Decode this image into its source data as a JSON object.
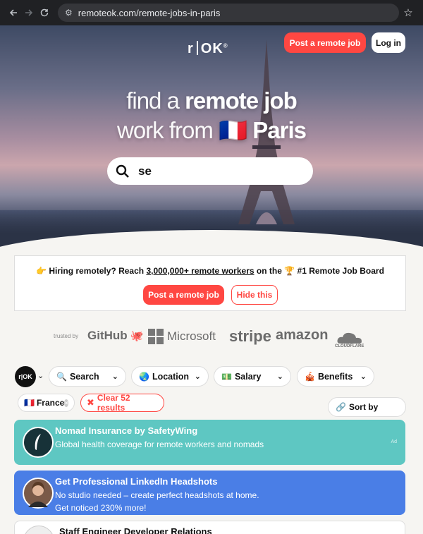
{
  "browser": {
    "url": "remoteok.com/remote-jobs-in-paris",
    "back_icon": "arrow-left-icon",
    "forward_icon": "arrow-right-icon",
    "reload_icon": "reload-icon",
    "bookmark_icon": "star-icon"
  },
  "header": {
    "logo_left": "r",
    "logo_right": "OK",
    "logo_mark": "®",
    "post_job_label": "Post a remote job",
    "login_label": "Log in"
  },
  "hero": {
    "line1_light": "find a",
    "line1_bold": "remote job",
    "line2_light": "work from",
    "flag": "🇫🇷",
    "line2_bold": "Paris"
  },
  "search": {
    "value": "se"
  },
  "hiring_banner": {
    "emoji": "👉",
    "text_before": "Hiring remotely? Reach",
    "link_text": "3,000,000+ remote workers",
    "text_middle": "on the",
    "trophy": "🏆",
    "text_after": "#1 Remote Job Board",
    "post_label": "Post a remote job",
    "hide_label": "Hide this"
  },
  "trusted": {
    "label": "trusted by",
    "brands": [
      "GitHub",
      "Microsoft",
      "stripe",
      "amazon",
      "CLOUDFLARE"
    ]
  },
  "filters": {
    "logo_left": "r",
    "logo_right": "OK",
    "search_label": "Search",
    "search_icon": "🔍",
    "location_label": "Location",
    "location_icon": "🌏",
    "salary_label": "Salary",
    "salary_icon": "💵",
    "benefits_label": "Benefits",
    "benefits_icon": "🎪"
  },
  "active_tags": {
    "france_flag": "🇫🇷",
    "france_label": "France",
    "clear_label": "Clear 52 results",
    "sort_label": "Sort by",
    "sort_icon": "🔗"
  },
  "cards": [
    {
      "title": "Nomad Insurance by SafetyWing",
      "desc": "Global health coverage for remote workers and nomads",
      "ad": "Ad",
      "color": "#5ec7c2"
    },
    {
      "title": "Get Professional LinkedIn Headshots",
      "desc": "No studio needed – create perfect headshots at home. Get noticed 230% more!",
      "color": "#4a7ee6"
    },
    {
      "title": "Staff Engineer Developer Relations"
    }
  ]
}
